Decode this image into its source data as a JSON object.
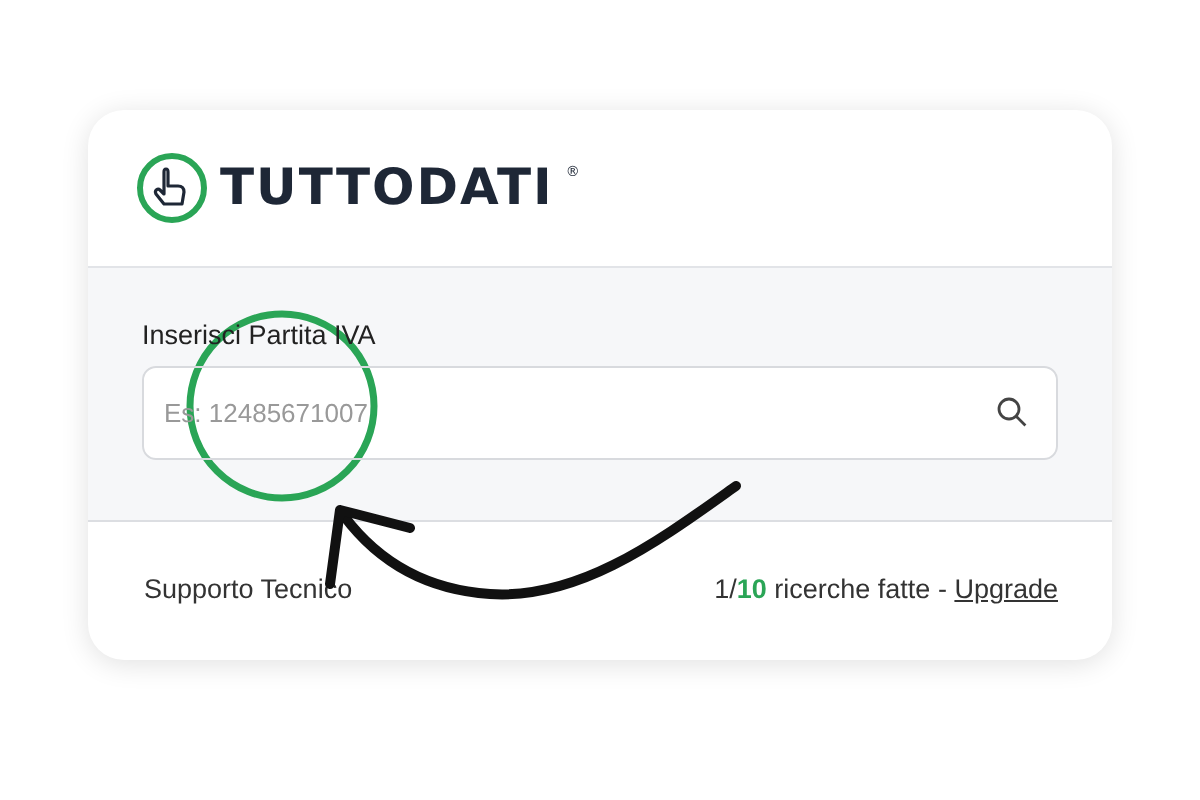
{
  "logo": {
    "text": "TUTTODATI",
    "mark": "®"
  },
  "search": {
    "label": "Inserisci Partita IVA",
    "placeholder": "Es: 12485671007"
  },
  "footer": {
    "support": "Supporto Tecnico",
    "usage": "1/**10** ricerche fatte - ",
    "upgrade": "Upgrade"
  }
}
